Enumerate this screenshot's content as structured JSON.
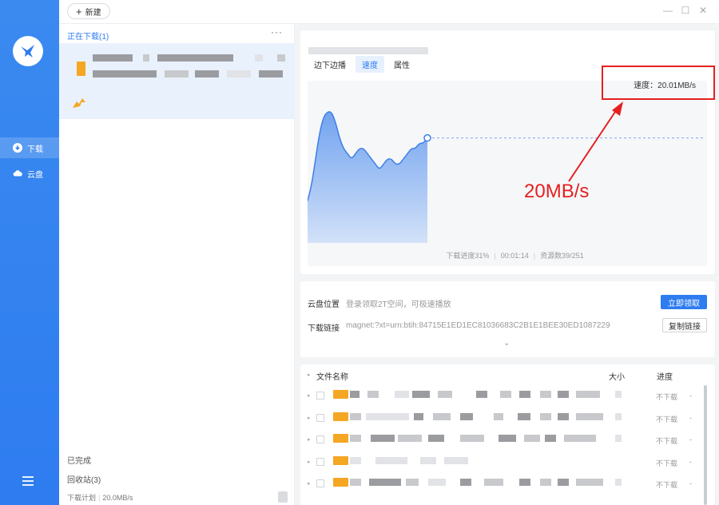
{
  "toolbar": {
    "new_label": "新建"
  },
  "sidebar": {
    "items": [
      {
        "label": "下载"
      },
      {
        "label": "云盘"
      }
    ]
  },
  "list": {
    "section_title": "正在下载(1)",
    "more": "···",
    "completed": "已完成",
    "recycle": "回收站(3)",
    "plan_label": "下载计划",
    "plan_value": "20.0MB/s"
  },
  "detail": {
    "tabs": [
      "边下边播",
      "速度",
      "属性"
    ],
    "speed_label": "速度：20.01MB/s",
    "annotation": "20MB/s",
    "stats": {
      "progress": "下载进度31%",
      "elapsed": "00:01:14",
      "sources": "资源数39/251"
    }
  },
  "info": {
    "cloud_key": "云盘位置",
    "cloud_value": "登录领取2T空间，可极速播放",
    "cloud_btn": "立即领取",
    "link_key": "下载链接",
    "link_value": "magnet:?xt=urn:btih:84715E1ED1EC81036683C2B1E1BEE30ED1087229",
    "copy_btn": "复制链接"
  },
  "files": {
    "col_name": "文件名称",
    "col_size": "大小",
    "col_progress": "进度",
    "rows": [
      {
        "status": "不下载"
      },
      {
        "status": "不下载"
      },
      {
        "status": "不下载"
      },
      {
        "status": "不下载"
      },
      {
        "status": "不下载"
      }
    ]
  },
  "chart_data": {
    "type": "area",
    "title": "",
    "xlabel": "",
    "ylabel": "",
    "ylim": [
      0,
      30
    ],
    "x": [
      0,
      1,
      2,
      3,
      4,
      5,
      6,
      7,
      8,
      9,
      10,
      11,
      12,
      13,
      14,
      15,
      16,
      17,
      18,
      19,
      20,
      21,
      22,
      23,
      24,
      25,
      26,
      27,
      28,
      29,
      30
    ],
    "series": [
      {
        "values": [
          8,
          11,
          16,
          21,
          24,
          25,
          25,
          23,
          20,
          18,
          17,
          16,
          17,
          18,
          18,
          17,
          16,
          15,
          14,
          15,
          16,
          16,
          15,
          15,
          16,
          17,
          18,
          18,
          19,
          19,
          20
        ]
      }
    ],
    "current_speed_mbps": 20.01
  },
  "colors": {
    "accent": "#2e7cf0",
    "annotation": "#e52020",
    "file_icon": "#f5a623"
  }
}
